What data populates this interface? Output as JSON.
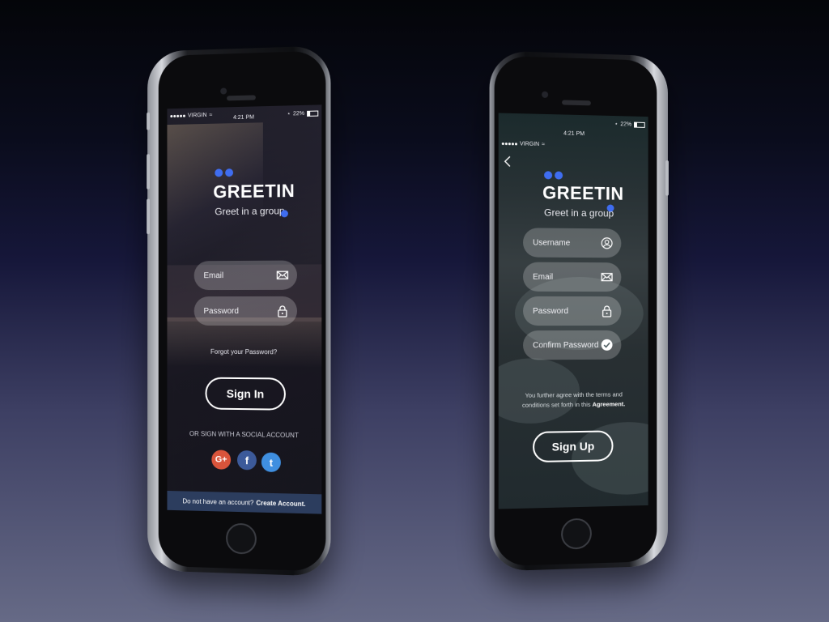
{
  "colors": {
    "accent": "#3f6df0",
    "footer": "#2c3d5e",
    "google": "#d9543b",
    "facebook": "#3c5a9a",
    "twitter": "#3f8fe0"
  },
  "signin_screen": {
    "status": {
      "carrier": "VIRGIN",
      "time": "4:21 PM",
      "battery": "22%"
    },
    "brand": "GREETIN",
    "tagline": "Greet in a group",
    "email_placeholder": "Email",
    "password_placeholder": "Password",
    "forgot": "Forgot your Password?",
    "sign_in": "Sign In",
    "social_label": "OR SIGN WITH A SOCIAL ACCOUNT",
    "social": {
      "google": "G+",
      "facebook": "f",
      "twitter": "t"
    },
    "footer_text": "Do not have an account?",
    "footer_link": "Create Account."
  },
  "signup_screen": {
    "status": {
      "carrier": "VIRGIN",
      "time": "4:21 PM",
      "battery": "22%"
    },
    "brand": "GREETIN",
    "tagline": "Greet in a group",
    "username_placeholder": "Username",
    "email_placeholder": "Email",
    "password_placeholder": "Password",
    "confirm_placeholder": "Confirm Password",
    "terms_text": "You further agree with the terms and conditions set forth in this",
    "terms_link": "Agreement.",
    "sign_up": "Sign Up"
  }
}
